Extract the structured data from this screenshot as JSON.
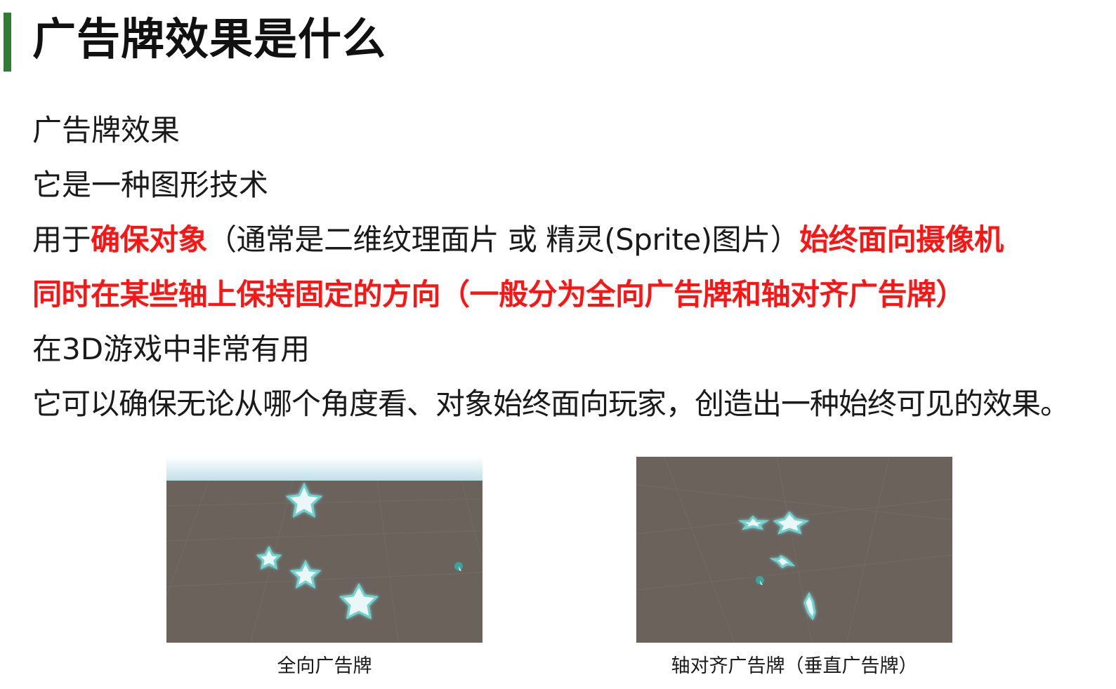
{
  "slide": {
    "title": "广告牌效果是什么",
    "lines": [
      {
        "segments": [
          {
            "text": "广告牌效果",
            "emphasis": false
          }
        ]
      },
      {
        "segments": [
          {
            "text": "它是一种图形技术",
            "emphasis": false
          }
        ]
      },
      {
        "segments": [
          {
            "text": "用于",
            "emphasis": false
          },
          {
            "text": "确保对象",
            "emphasis": true
          },
          {
            "text": "（通常是二维纹理面片 或 精灵(Sprite)图片）",
            "emphasis": false
          },
          {
            "text": "始终面向摄像机",
            "emphasis": true
          }
        ]
      },
      {
        "segments": [
          {
            "text": "同时在某些轴上保持固定的方向（一般分为全向广告牌和轴对齐广告牌）",
            "emphasis": true
          }
        ]
      },
      {
        "segments": [
          {
            "text": "在3D游戏中非常有用",
            "emphasis": false
          }
        ]
      },
      {
        "segments": [
          {
            "text": "它可以确保无论从哪个角度看、对象始终面向玩家，创造出一种始终可见的效果。",
            "emphasis": false
          }
        ]
      }
    ]
  },
  "figures": {
    "left": {
      "caption": "全向广告牌",
      "sprite_icon": "star-icon"
    },
    "right": {
      "caption": "轴对齐广告牌（垂直广告牌）",
      "sprite_icon": "star-icon"
    }
  },
  "colors": {
    "accent_bar": "#2e7d32",
    "emphasis_text": "#ff1414",
    "scene_ground": "#6b625c",
    "scene_sky": "#cfe8ee",
    "sprite_fill": "#e8f6f5",
    "sprite_glow": "#6fd3cf",
    "gizmo": "#3aa39a"
  }
}
